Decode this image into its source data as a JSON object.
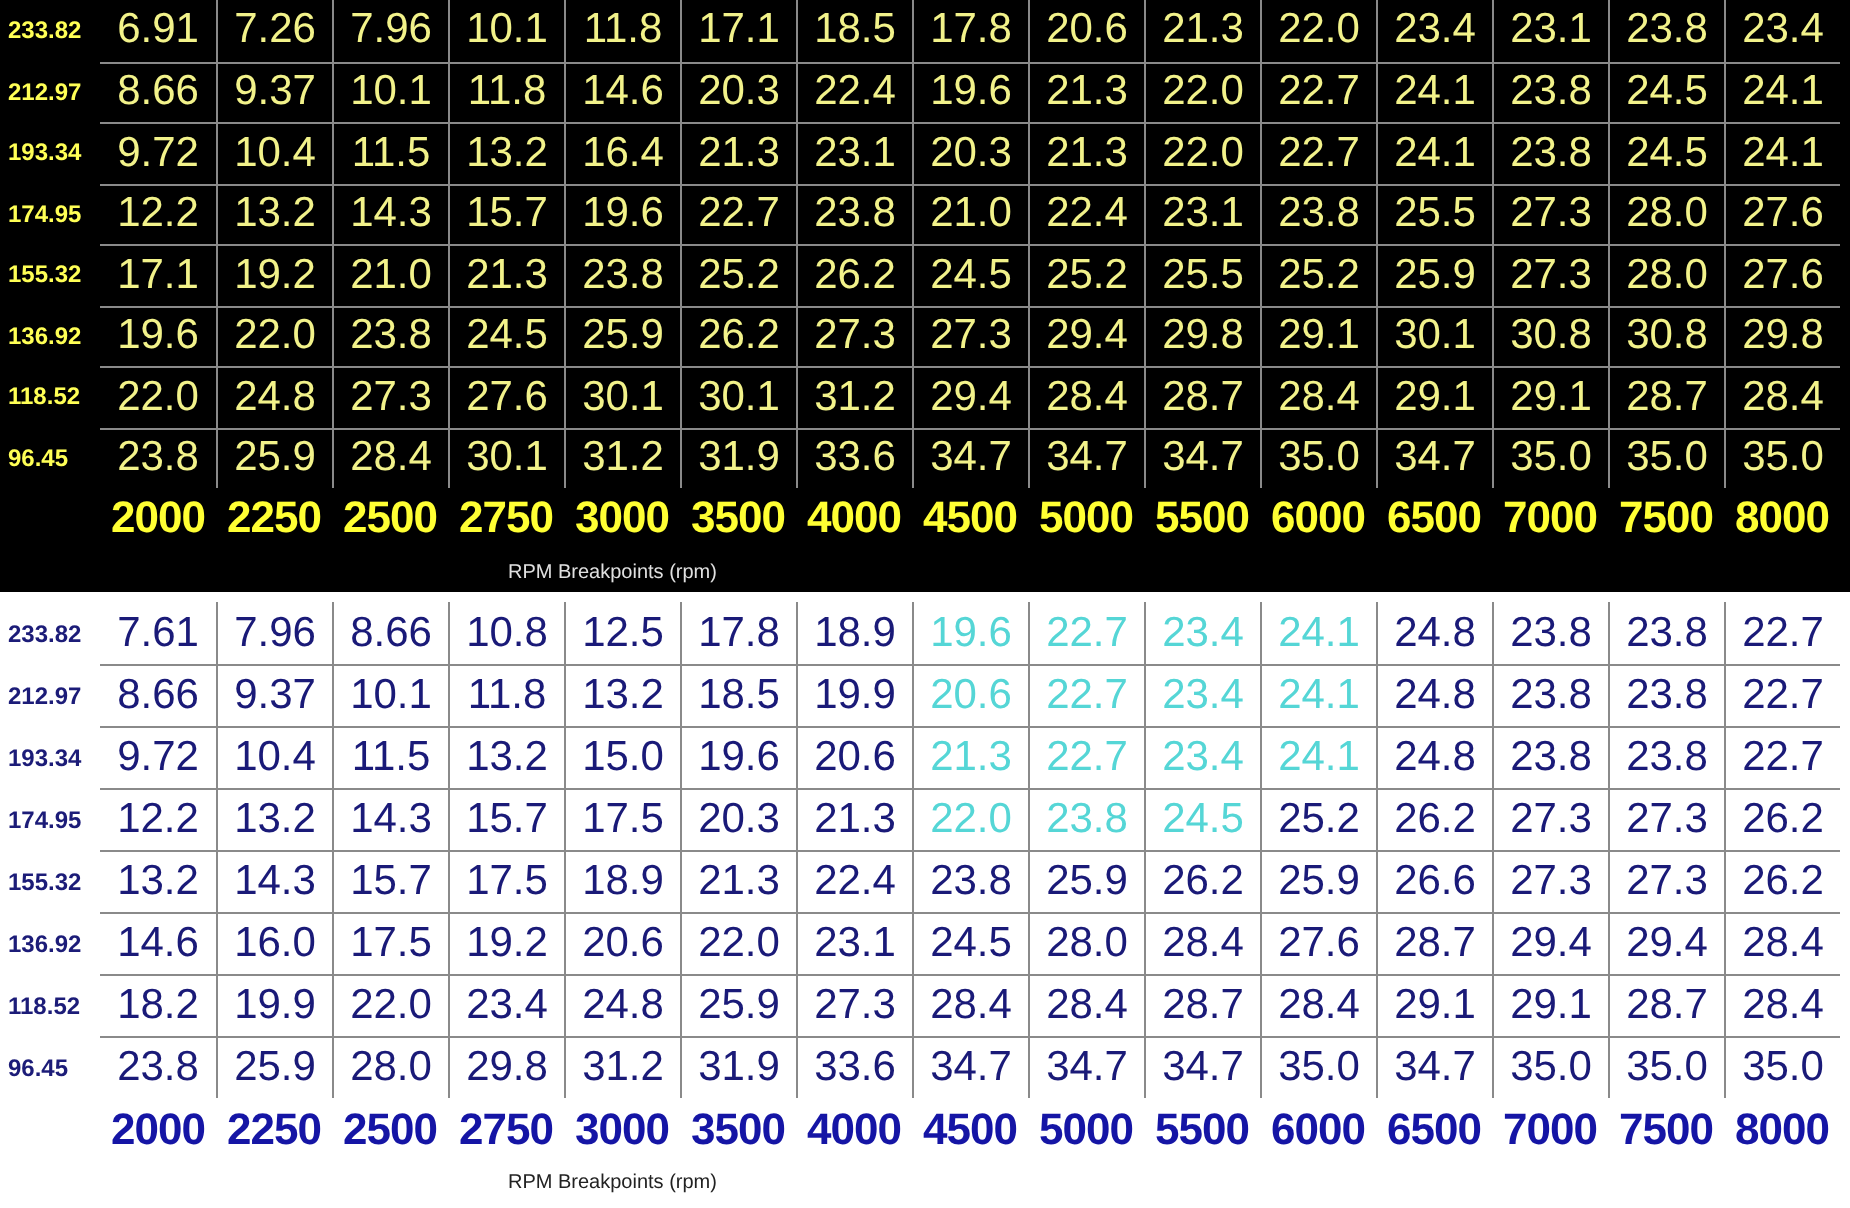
{
  "tables": [
    {
      "kind": "dark",
      "caption": "RPM Breakpoints (rpm)",
      "rpm": [
        "2000",
        "2250",
        "2500",
        "2750",
        "3000",
        "3500",
        "4000",
        "4500",
        "5000",
        "5500",
        "6000",
        "6500",
        "7000",
        "7500",
        "8000"
      ],
      "rows": [
        {
          "label": "233.82",
          "cells": [
            {
              "value": "6.91",
              "highlighted": false
            },
            {
              "value": "7.26",
              "highlighted": false
            },
            {
              "value": "7.96",
              "highlighted": false
            },
            {
              "value": "10.1",
              "highlighted": false
            },
            {
              "value": "11.8",
              "highlighted": false
            },
            {
              "value": "17.1",
              "highlighted": false
            },
            {
              "value": "18.5",
              "highlighted": false
            },
            {
              "value": "17.8",
              "highlighted": false
            },
            {
              "value": "20.6",
              "highlighted": false
            },
            {
              "value": "21.3",
              "highlighted": false
            },
            {
              "value": "22.0",
              "highlighted": false
            },
            {
              "value": "23.4",
              "highlighted": false
            },
            {
              "value": "23.1",
              "highlighted": false
            },
            {
              "value": "23.8",
              "highlighted": false
            },
            {
              "value": "23.4",
              "highlighted": false
            }
          ]
        },
        {
          "label": "212.97",
          "cells": [
            {
              "value": "8.66",
              "highlighted": false
            },
            {
              "value": "9.37",
              "highlighted": false
            },
            {
              "value": "10.1",
              "highlighted": false
            },
            {
              "value": "11.8",
              "highlighted": false
            },
            {
              "value": "14.6",
              "highlighted": false
            },
            {
              "value": "20.3",
              "highlighted": false
            },
            {
              "value": "22.4",
              "highlighted": false
            },
            {
              "value": "19.6",
              "highlighted": false
            },
            {
              "value": "21.3",
              "highlighted": false
            },
            {
              "value": "22.0",
              "highlighted": false
            },
            {
              "value": "22.7",
              "highlighted": false
            },
            {
              "value": "24.1",
              "highlighted": false
            },
            {
              "value": "23.8",
              "highlighted": false
            },
            {
              "value": "24.5",
              "highlighted": false
            },
            {
              "value": "24.1",
              "highlighted": false
            }
          ]
        },
        {
          "label": "193.34",
          "cells": [
            {
              "value": "9.72",
              "highlighted": false
            },
            {
              "value": "10.4",
              "highlighted": false
            },
            {
              "value": "11.5",
              "highlighted": false
            },
            {
              "value": "13.2",
              "highlighted": false
            },
            {
              "value": "16.4",
              "highlighted": false
            },
            {
              "value": "21.3",
              "highlighted": false
            },
            {
              "value": "23.1",
              "highlighted": false
            },
            {
              "value": "20.3",
              "highlighted": false
            },
            {
              "value": "21.3",
              "highlighted": false
            },
            {
              "value": "22.0",
              "highlighted": false
            },
            {
              "value": "22.7",
              "highlighted": false
            },
            {
              "value": "24.1",
              "highlighted": false
            },
            {
              "value": "23.8",
              "highlighted": false
            },
            {
              "value": "24.5",
              "highlighted": false
            },
            {
              "value": "24.1",
              "highlighted": false
            }
          ]
        },
        {
          "label": "174.95",
          "cells": [
            {
              "value": "12.2",
              "highlighted": false
            },
            {
              "value": "13.2",
              "highlighted": false
            },
            {
              "value": "14.3",
              "highlighted": false
            },
            {
              "value": "15.7",
              "highlighted": false
            },
            {
              "value": "19.6",
              "highlighted": false
            },
            {
              "value": "22.7",
              "highlighted": false
            },
            {
              "value": "23.8",
              "highlighted": false
            },
            {
              "value": "21.0",
              "highlighted": false
            },
            {
              "value": "22.4",
              "highlighted": false
            },
            {
              "value": "23.1",
              "highlighted": false
            },
            {
              "value": "23.8",
              "highlighted": false
            },
            {
              "value": "25.5",
              "highlighted": false
            },
            {
              "value": "27.3",
              "highlighted": false
            },
            {
              "value": "28.0",
              "highlighted": false
            },
            {
              "value": "27.6",
              "highlighted": false
            }
          ]
        },
        {
          "label": "155.32",
          "cells": [
            {
              "value": "17.1",
              "highlighted": false
            },
            {
              "value": "19.2",
              "highlighted": false
            },
            {
              "value": "21.0",
              "highlighted": false
            },
            {
              "value": "21.3",
              "highlighted": false
            },
            {
              "value": "23.8",
              "highlighted": false
            },
            {
              "value": "25.2",
              "highlighted": false
            },
            {
              "value": "26.2",
              "highlighted": false
            },
            {
              "value": "24.5",
              "highlighted": false
            },
            {
              "value": "25.2",
              "highlighted": false
            },
            {
              "value": "25.5",
              "highlighted": false
            },
            {
              "value": "25.2",
              "highlighted": false
            },
            {
              "value": "25.9",
              "highlighted": false
            },
            {
              "value": "27.3",
              "highlighted": false
            },
            {
              "value": "28.0",
              "highlighted": false
            },
            {
              "value": "27.6",
              "highlighted": false
            }
          ]
        },
        {
          "label": "136.92",
          "cells": [
            {
              "value": "19.6",
              "highlighted": false
            },
            {
              "value": "22.0",
              "highlighted": false
            },
            {
              "value": "23.8",
              "highlighted": false
            },
            {
              "value": "24.5",
              "highlighted": false
            },
            {
              "value": "25.9",
              "highlighted": false
            },
            {
              "value": "26.2",
              "highlighted": false
            },
            {
              "value": "27.3",
              "highlighted": false
            },
            {
              "value": "27.3",
              "highlighted": false
            },
            {
              "value": "29.4",
              "highlighted": false
            },
            {
              "value": "29.8",
              "highlighted": false
            },
            {
              "value": "29.1",
              "highlighted": false
            },
            {
              "value": "30.1",
              "highlighted": false
            },
            {
              "value": "30.8",
              "highlighted": false
            },
            {
              "value": "30.8",
              "highlighted": false
            },
            {
              "value": "29.8",
              "highlighted": false
            }
          ]
        },
        {
          "label": "118.52",
          "cells": [
            {
              "value": "22.0",
              "highlighted": false
            },
            {
              "value": "24.8",
              "highlighted": false
            },
            {
              "value": "27.3",
              "highlighted": false
            },
            {
              "value": "27.6",
              "highlighted": false
            },
            {
              "value": "30.1",
              "highlighted": false
            },
            {
              "value": "30.1",
              "highlighted": false
            },
            {
              "value": "31.2",
              "highlighted": false
            },
            {
              "value": "29.4",
              "highlighted": false
            },
            {
              "value": "28.4",
              "highlighted": false
            },
            {
              "value": "28.7",
              "highlighted": false
            },
            {
              "value": "28.4",
              "highlighted": false
            },
            {
              "value": "29.1",
              "highlighted": false
            },
            {
              "value": "29.1",
              "highlighted": false
            },
            {
              "value": "28.7",
              "highlighted": false
            },
            {
              "value": "28.4",
              "highlighted": false
            }
          ]
        },
        {
          "label": "96.45",
          "cells": [
            {
              "value": "23.8",
              "highlighted": false
            },
            {
              "value": "25.9",
              "highlighted": false
            },
            {
              "value": "28.4",
              "highlighted": false
            },
            {
              "value": "30.1",
              "highlighted": false
            },
            {
              "value": "31.2",
              "highlighted": false
            },
            {
              "value": "31.9",
              "highlighted": false
            },
            {
              "value": "33.6",
              "highlighted": false
            },
            {
              "value": "34.7",
              "highlighted": false
            },
            {
              "value": "34.7",
              "highlighted": false
            },
            {
              "value": "34.7",
              "highlighted": false
            },
            {
              "value": "35.0",
              "highlighted": false
            },
            {
              "value": "34.7",
              "highlighted": false
            },
            {
              "value": "35.0",
              "highlighted": false
            },
            {
              "value": "35.0",
              "highlighted": false
            },
            {
              "value": "35.0",
              "highlighted": false
            }
          ]
        }
      ]
    },
    {
      "kind": "light",
      "caption": "RPM Breakpoints (rpm)",
      "rpm": [
        "2000",
        "2250",
        "2500",
        "2750",
        "3000",
        "3500",
        "4000",
        "4500",
        "5000",
        "5500",
        "6000",
        "6500",
        "7000",
        "7500",
        "8000"
      ],
      "rows": [
        {
          "label": "233.82",
          "cells": [
            {
              "value": "7.61",
              "highlighted": false
            },
            {
              "value": "7.96",
              "highlighted": false
            },
            {
              "value": "8.66",
              "highlighted": false
            },
            {
              "value": "10.8",
              "highlighted": false
            },
            {
              "value": "12.5",
              "highlighted": false
            },
            {
              "value": "17.8",
              "highlighted": false
            },
            {
              "value": "18.9",
              "highlighted": false
            },
            {
              "value": "19.6",
              "highlighted": true
            },
            {
              "value": "22.7",
              "highlighted": true
            },
            {
              "value": "23.4",
              "highlighted": true
            },
            {
              "value": "24.1",
              "highlighted": true
            },
            {
              "value": "24.8",
              "highlighted": false
            },
            {
              "value": "23.8",
              "highlighted": false
            },
            {
              "value": "23.8",
              "highlighted": false
            },
            {
              "value": "22.7",
              "highlighted": false
            }
          ]
        },
        {
          "label": "212.97",
          "cells": [
            {
              "value": "8.66",
              "highlighted": false
            },
            {
              "value": "9.37",
              "highlighted": false
            },
            {
              "value": "10.1",
              "highlighted": false
            },
            {
              "value": "11.8",
              "highlighted": false
            },
            {
              "value": "13.2",
              "highlighted": false
            },
            {
              "value": "18.5",
              "highlighted": false
            },
            {
              "value": "19.9",
              "highlighted": false
            },
            {
              "value": "20.6",
              "highlighted": true
            },
            {
              "value": "22.7",
              "highlighted": true
            },
            {
              "value": "23.4",
              "highlighted": true
            },
            {
              "value": "24.1",
              "highlighted": true
            },
            {
              "value": "24.8",
              "highlighted": false
            },
            {
              "value": "23.8",
              "highlighted": false
            },
            {
              "value": "23.8",
              "highlighted": false
            },
            {
              "value": "22.7",
              "highlighted": false
            }
          ]
        },
        {
          "label": "193.34",
          "cells": [
            {
              "value": "9.72",
              "highlighted": false
            },
            {
              "value": "10.4",
              "highlighted": false
            },
            {
              "value": "11.5",
              "highlighted": false
            },
            {
              "value": "13.2",
              "highlighted": false
            },
            {
              "value": "15.0",
              "highlighted": false
            },
            {
              "value": "19.6",
              "highlighted": false
            },
            {
              "value": "20.6",
              "highlighted": false
            },
            {
              "value": "21.3",
              "highlighted": true
            },
            {
              "value": "22.7",
              "highlighted": true
            },
            {
              "value": "23.4",
              "highlighted": true
            },
            {
              "value": "24.1",
              "highlighted": true
            },
            {
              "value": "24.8",
              "highlighted": false
            },
            {
              "value": "23.8",
              "highlighted": false
            },
            {
              "value": "23.8",
              "highlighted": false
            },
            {
              "value": "22.7",
              "highlighted": false
            }
          ]
        },
        {
          "label": "174.95",
          "cells": [
            {
              "value": "12.2",
              "highlighted": false
            },
            {
              "value": "13.2",
              "highlighted": false
            },
            {
              "value": "14.3",
              "highlighted": false
            },
            {
              "value": "15.7",
              "highlighted": false
            },
            {
              "value": "17.5",
              "highlighted": false
            },
            {
              "value": "20.3",
              "highlighted": false
            },
            {
              "value": "21.3",
              "highlighted": false
            },
            {
              "value": "22.0",
              "highlighted": true
            },
            {
              "value": "23.8",
              "highlighted": true
            },
            {
              "value": "24.5",
              "highlighted": true
            },
            {
              "value": "25.2",
              "highlighted": false
            },
            {
              "value": "26.2",
              "highlighted": false
            },
            {
              "value": "27.3",
              "highlighted": false
            },
            {
              "value": "27.3",
              "highlighted": false
            },
            {
              "value": "26.2",
              "highlighted": false
            }
          ]
        },
        {
          "label": "155.32",
          "cells": [
            {
              "value": "13.2",
              "highlighted": false
            },
            {
              "value": "14.3",
              "highlighted": false
            },
            {
              "value": "15.7",
              "highlighted": false
            },
            {
              "value": "17.5",
              "highlighted": false
            },
            {
              "value": "18.9",
              "highlighted": false
            },
            {
              "value": "21.3",
              "highlighted": false
            },
            {
              "value": "22.4",
              "highlighted": false
            },
            {
              "value": "23.8",
              "highlighted": false
            },
            {
              "value": "25.9",
              "highlighted": false
            },
            {
              "value": "26.2",
              "highlighted": false
            },
            {
              "value": "25.9",
              "highlighted": false
            },
            {
              "value": "26.6",
              "highlighted": false
            },
            {
              "value": "27.3",
              "highlighted": false
            },
            {
              "value": "27.3",
              "highlighted": false
            },
            {
              "value": "26.2",
              "highlighted": false
            }
          ]
        },
        {
          "label": "136.92",
          "cells": [
            {
              "value": "14.6",
              "highlighted": false
            },
            {
              "value": "16.0",
              "highlighted": false
            },
            {
              "value": "17.5",
              "highlighted": false
            },
            {
              "value": "19.2",
              "highlighted": false
            },
            {
              "value": "20.6",
              "highlighted": false
            },
            {
              "value": "22.0",
              "highlighted": false
            },
            {
              "value": "23.1",
              "highlighted": false
            },
            {
              "value": "24.5",
              "highlighted": false
            },
            {
              "value": "28.0",
              "highlighted": false
            },
            {
              "value": "28.4",
              "highlighted": false
            },
            {
              "value": "27.6",
              "highlighted": false
            },
            {
              "value": "28.7",
              "highlighted": false
            },
            {
              "value": "29.4",
              "highlighted": false
            },
            {
              "value": "29.4",
              "highlighted": false
            },
            {
              "value": "28.4",
              "highlighted": false
            }
          ]
        },
        {
          "label": "118.52",
          "cells": [
            {
              "value": "18.2",
              "highlighted": false
            },
            {
              "value": "19.9",
              "highlighted": false
            },
            {
              "value": "22.0",
              "highlighted": false
            },
            {
              "value": "23.4",
              "highlighted": false
            },
            {
              "value": "24.8",
              "highlighted": false
            },
            {
              "value": "25.9",
              "highlighted": false
            },
            {
              "value": "27.3",
              "highlighted": false
            },
            {
              "value": "28.4",
              "highlighted": false
            },
            {
              "value": "28.4",
              "highlighted": false
            },
            {
              "value": "28.7",
              "highlighted": false
            },
            {
              "value": "28.4",
              "highlighted": false
            },
            {
              "value": "29.1",
              "highlighted": false
            },
            {
              "value": "29.1",
              "highlighted": false
            },
            {
              "value": "28.7",
              "highlighted": false
            },
            {
              "value": "28.4",
              "highlighted": false
            }
          ]
        },
        {
          "label": "96.45",
          "cells": [
            {
              "value": "23.8",
              "highlighted": false
            },
            {
              "value": "25.9",
              "highlighted": false
            },
            {
              "value": "28.0",
              "highlighted": false
            },
            {
              "value": "29.8",
              "highlighted": false
            },
            {
              "value": "31.2",
              "highlighted": false
            },
            {
              "value": "31.9",
              "highlighted": false
            },
            {
              "value": "33.6",
              "highlighted": false
            },
            {
              "value": "34.7",
              "highlighted": false
            },
            {
              "value": "34.7",
              "highlighted": false
            },
            {
              "value": "34.7",
              "highlighted": false
            },
            {
              "value": "35.0",
              "highlighted": false
            },
            {
              "value": "34.7",
              "highlighted": false
            },
            {
              "value": "35.0",
              "highlighted": false
            },
            {
              "value": "35.0",
              "highlighted": false
            },
            {
              "value": "35.0",
              "highlighted": false
            }
          ]
        }
      ]
    }
  ]
}
